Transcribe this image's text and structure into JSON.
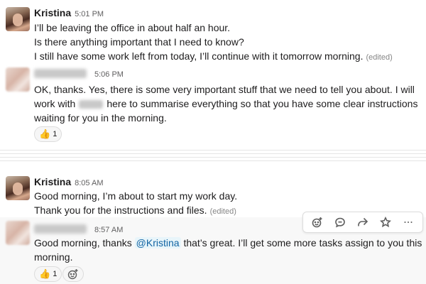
{
  "messages": [
    {
      "author": "Kristina",
      "time": "5:01 PM",
      "lines": [
        "I’ll be leaving the office in about half an hour.",
        "Is there anything important that I need to know?",
        "I still have some work left from today, I’ll continue with it tomorrow morning."
      ],
      "edited": "(edited)"
    },
    {
      "author": "",
      "time": "5:06 PM",
      "lines": [
        "OK, thanks.  Yes, there is some very important stuff that we need to tell you about.  I will",
        "work with",
        "here to summarise everything so that you have some clear instructions",
        "waiting for you in the morning."
      ],
      "reaction": {
        "emoji": "👍",
        "count": "1"
      }
    },
    {
      "author": "Kristina",
      "time": "8:05 AM",
      "lines": [
        "Good morning, I’m about to start my work day.",
        "Thank you for the instructions and files."
      ],
      "edited": "(edited)"
    },
    {
      "author": "",
      "time": "8:57 AM",
      "line1_before": "Good morning, thanks",
      "mention": "@Kristina",
      "line1_after": "that’s great.  I’ll get some more tasks assign to you this",
      "line2": "morning.",
      "reaction": {
        "emoji": "👍",
        "count": "1"
      }
    }
  ],
  "toolbar": {
    "icons": [
      "add-reaction-icon",
      "reply-in-thread-icon",
      "share-icon",
      "save-star-icon",
      "more-actions-icon"
    ]
  }
}
